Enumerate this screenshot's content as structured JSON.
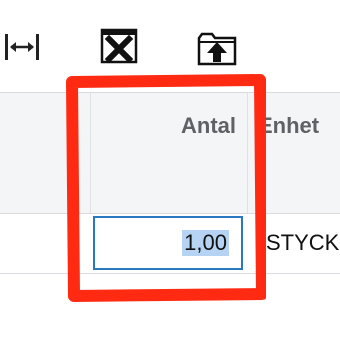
{
  "toolbar": {
    "resize_icon": "column-resize-icon",
    "excel_icon": "excel-export-icon",
    "upload_icon": "upload-icon"
  },
  "grid": {
    "headers": {
      "antal": "Antal",
      "enhet": "Enhet"
    },
    "row": {
      "quantity": "1,00",
      "unit": "STYCK"
    }
  },
  "highlight": {
    "color": "#ff2a12"
  }
}
